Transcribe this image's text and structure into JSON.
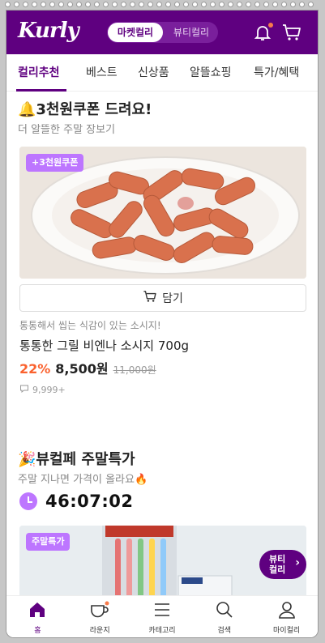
{
  "header": {
    "logo": "Kurly",
    "toggle_on": "마켓컬리",
    "toggle_off": "뷰티컬리"
  },
  "tabs": [
    "컬리추천",
    "베스트",
    "신상품",
    "알뜰쇼핑",
    "특가/혜택"
  ],
  "section1": {
    "title": "🔔3천원쿠폰 드려요!",
    "subtitle": "더 알뜰한 주말 장보기",
    "badge": "+3천원쿠폰",
    "cart_label": "담기",
    "description": "통통해서 씹는 식감이 있는 소시지!",
    "product_name": "통통한 그릴 비엔나 소시지 700g",
    "discount": "22%",
    "price": "8,500원",
    "original_price": "11,000원",
    "reviews": "9,999+"
  },
  "section2": {
    "title": "🎉뷰컬페 주말특가",
    "subtitle": "주말 지나면 가격이 올라요🔥",
    "timer": "46:07:02",
    "badge": "주말특가",
    "fab_line1": "뷰티",
    "fab_line2": "컬리"
  },
  "bottom_nav": [
    "홈",
    "라운지",
    "카테고리",
    "검색",
    "마이컬리"
  ],
  "colors": {
    "brand": "#5f0080",
    "accent": "#bd76ff",
    "discount": "#fa622f"
  }
}
